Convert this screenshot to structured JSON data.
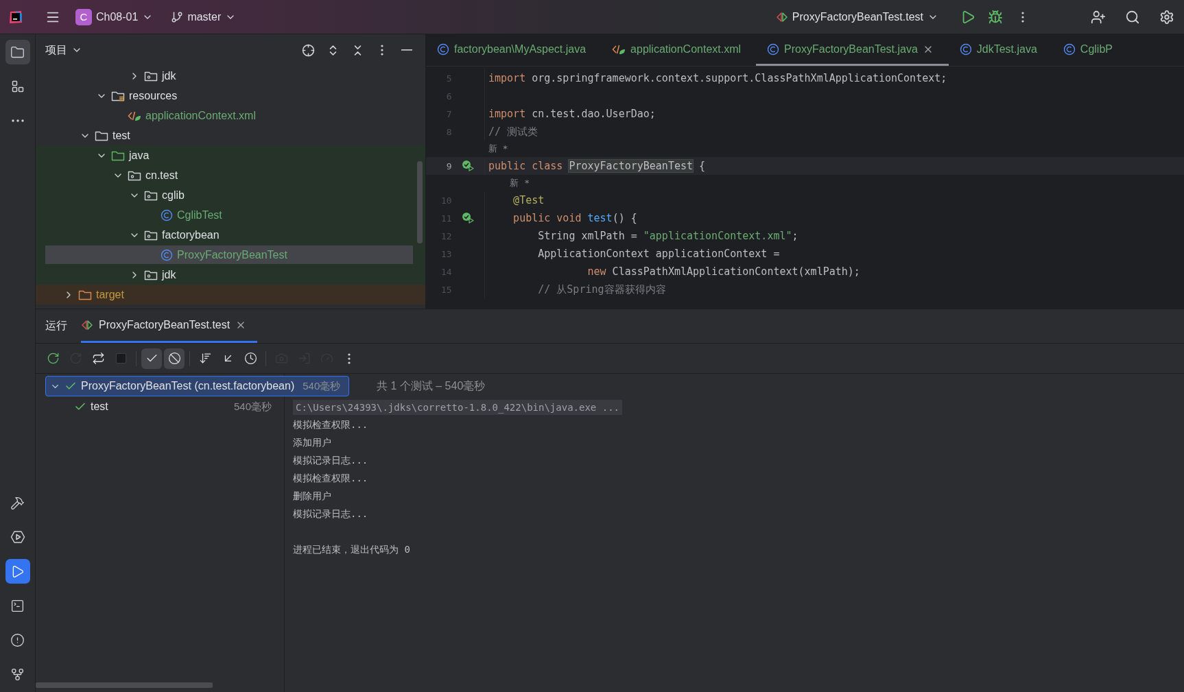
{
  "top_bar": {
    "project_badge": "C",
    "project": "Ch08-01",
    "branch": "master",
    "run_config": "ProxyFactoryBeanTest.test"
  },
  "tool_strip": {
    "top": [
      {
        "kind": "project",
        "selected": true
      },
      {
        "kind": "structure",
        "selected": false
      },
      {
        "kind": "more",
        "selected": false
      }
    ],
    "bottom": [
      {
        "kind": "build",
        "selected": false
      },
      {
        "kind": "services",
        "selected": false
      },
      {
        "kind": "run",
        "selected": true
      },
      {
        "kind": "terminal",
        "selected": false
      },
      {
        "kind": "problems",
        "selected": false
      },
      {
        "kind": "git",
        "selected": false
      }
    ]
  },
  "project_panel": {
    "title": "项目",
    "tree": [
      {
        "children": [
          {
            "children": [
              {
                "children": [
                  {
                    "children": [
                      {
                        "label": "jdk",
                        "kind": "package",
                        "expanded": false,
                        "selected": false,
                        "color": "#dfe1e5"
                      }
                    ]
                  }
                ]
              },
              {
                "label": "resources",
                "kind": "resources",
                "expanded": true,
                "selected": false,
                "color": "#dfe1e5",
                "children": [
                  {
                    "label": "applicationContext.xml",
                    "kind": "xml",
                    "selected": false,
                    "color": "#6aab73"
                  }
                ]
              }
            ]
          },
          {
            "label": "test",
            "kind": "folder",
            "expanded": true,
            "selected": false,
            "color": "#dfe1e5",
            "children": [
              {
                "label": "java",
                "kind": "test_root",
                "expanded": true,
                "selected": false,
                "color": "#dfe1e5",
                "children": [
                  {
                    "label": "cn.test",
                    "kind": "package",
                    "expanded": true,
                    "selected": false,
                    "color": "#dfe1e5",
                    "children": [
                      {
                        "label": "cglib",
                        "kind": "package",
                        "expanded": true,
                        "selected": false,
                        "color": "#dfe1e5",
                        "children": [
                          {
                            "label": "CglibTest",
                            "kind": "class",
                            "selected": false,
                            "color": "#6aab73"
                          }
                        ]
                      },
                      {
                        "label": "factorybean",
                        "kind": "package",
                        "expanded": true,
                        "selected": false,
                        "color": "#dfe1e5",
                        "children": [
                          {
                            "label": "ProxyFactoryBeanTest",
                            "kind": "class",
                            "selected": true,
                            "color": "#6aab73"
                          }
                        ]
                      },
                      {
                        "label": "jdk",
                        "kind": "package",
                        "expanded": false,
                        "selected": false,
                        "color": "#dfe1e5"
                      }
                    ]
                  }
                ]
              }
            ]
          }
        ]
      },
      {
        "label": "target",
        "kind": "excluded",
        "expanded": false,
        "selected": false,
        "color": "#c4993f"
      }
    ]
  },
  "editor": {
    "tabs": [
      {
        "label": "factorybean\\MyAspect.java",
        "kind": "class",
        "selected": false
      },
      {
        "label": "applicationContext.xml",
        "kind": "xml",
        "selected": false
      },
      {
        "label": "ProxyFactoryBeanTest.java",
        "kind": "class",
        "selected": true
      },
      {
        "label": "JdkTest.java",
        "kind": "class",
        "selected": false
      },
      {
        "label": "CglibP",
        "kind": "class",
        "selected": false
      }
    ],
    "lines": [
      {
        "kind": "code",
        "number": "5",
        "current": false,
        "marker": false,
        "tokens": [
          {
            "kind": "kw",
            "t": "import"
          },
          {
            "kind": "plain",
            "t": " org.springframework.context.support.ClassPathXmlApplicationContext;"
          }
        ]
      },
      {
        "kind": "code",
        "number": "6",
        "current": false,
        "marker": false
      },
      {
        "kind": "code",
        "number": "7",
        "current": false,
        "marker": false,
        "tokens": [
          {
            "kind": "kw",
            "t": "import"
          },
          {
            "kind": "plain",
            "t": " cn.test.dao.UserDao;"
          }
        ]
      },
      {
        "kind": "code",
        "number": "8",
        "current": false,
        "marker": false,
        "tokens": [
          {
            "kind": "com",
            "t": "// 测试类"
          }
        ]
      },
      {
        "kind": "hint",
        "text": "新 *"
      },
      {
        "kind": "code",
        "number": "9",
        "current": true,
        "marker": true,
        "tokens": [
          {
            "kind": "kw",
            "t": "public class "
          },
          {
            "kind": "hl",
            "t": "ProxyFactoryBeanTest"
          },
          {
            "kind": "plain",
            "t": " {"
          }
        ]
      },
      {
        "kind": "hint",
        "text": "    新 *"
      },
      {
        "kind": "code",
        "number": "10",
        "current": false,
        "marker": false,
        "tokens": [
          {
            "kind": "ann",
            "t": "    @Test"
          }
        ]
      },
      {
        "kind": "code",
        "number": "11",
        "current": false,
        "marker": true,
        "tokens": [
          {
            "kind": "kw",
            "t": "    public void "
          },
          {
            "kind": "fn",
            "t": "test"
          },
          {
            "kind": "plain",
            "t": "() {"
          }
        ]
      },
      {
        "kind": "code",
        "number": "12",
        "current": false,
        "marker": false,
        "tokens": [
          {
            "kind": "plain",
            "t": "        String xmlPath = "
          },
          {
            "kind": "str",
            "t": "\"applicationContext.xml\""
          },
          {
            "kind": "plain",
            "t": ";"
          }
        ]
      },
      {
        "kind": "code",
        "number": "13",
        "current": false,
        "marker": false,
        "tokens": [
          {
            "kind": "plain",
            "t": "        ApplicationContext applicationContext ="
          }
        ]
      },
      {
        "kind": "code",
        "number": "14",
        "current": false,
        "marker": false,
        "tokens": [
          {
            "kind": "kw",
            "t": "                new"
          },
          {
            "kind": "plain",
            "t": " ClassPathXmlApplicationContext(xmlPath);"
          }
        ]
      },
      {
        "kind": "code",
        "number": "15",
        "current": false,
        "marker": false,
        "tokens": [
          {
            "kind": "com",
            "t": "        // 从Spring容器获得内容"
          }
        ]
      }
    ]
  },
  "run_panel": {
    "title": "运行",
    "tabs": [
      {
        "label": "ProxyFactoryBeanTest.test",
        "selected": true
      }
    ],
    "toolbar": [
      {
        "kind": "rerun",
        "disabled": false
      },
      {
        "kind": "rerun_failed",
        "disabled": true
      },
      {
        "kind": "toggle_auto",
        "disabled": false
      },
      {
        "kind": "stop",
        "disabled": true
      },
      {
        "kind": "separator"
      },
      {
        "kind": "show_passed",
        "on": true,
        "disabled": false
      },
      {
        "kind": "show_ignored",
        "on": true,
        "disabled": false
      },
      {
        "kind": "separator"
      },
      {
        "kind": "sort",
        "disabled": false
      },
      {
        "kind": "import",
        "disabled": false
      },
      {
        "kind": "history",
        "disabled": false
      },
      {
        "kind": "separator"
      },
      {
        "kind": "screenshot",
        "disabled": true
      },
      {
        "kind": "export",
        "disabled": true
      },
      {
        "kind": "coverage",
        "disabled": true
      },
      {
        "kind": "more",
        "disabled": false
      }
    ],
    "tests": [
      {
        "label": "ProxyFactoryBeanTest (cn.test.factorybean)",
        "time": "540毫秒",
        "passed": true,
        "expanded": true,
        "selected": true,
        "children": [
          {
            "label": "test",
            "time": "540毫秒",
            "passed": true,
            "selected": false
          }
        ]
      }
    ],
    "summary": "共 1 个测试 – 540毫秒",
    "console": [
      {
        "kind": "command",
        "text": "C:\\Users\\24393\\.jdks\\corretto-1.8.0_422\\bin\\java.exe ..."
      },
      {
        "kind": "output",
        "text": "模拟检查权限..."
      },
      {
        "kind": "output",
        "text": "添加用户"
      },
      {
        "kind": "output",
        "text": "模拟记录日志..."
      },
      {
        "kind": "output",
        "text": "模拟检查权限..."
      },
      {
        "kind": "output",
        "text": "删除用户"
      },
      {
        "kind": "output",
        "text": "模拟记录日志..."
      },
      {
        "kind": "exit",
        "text": "进程已结束，退出代码为 0"
      }
    ]
  }
}
